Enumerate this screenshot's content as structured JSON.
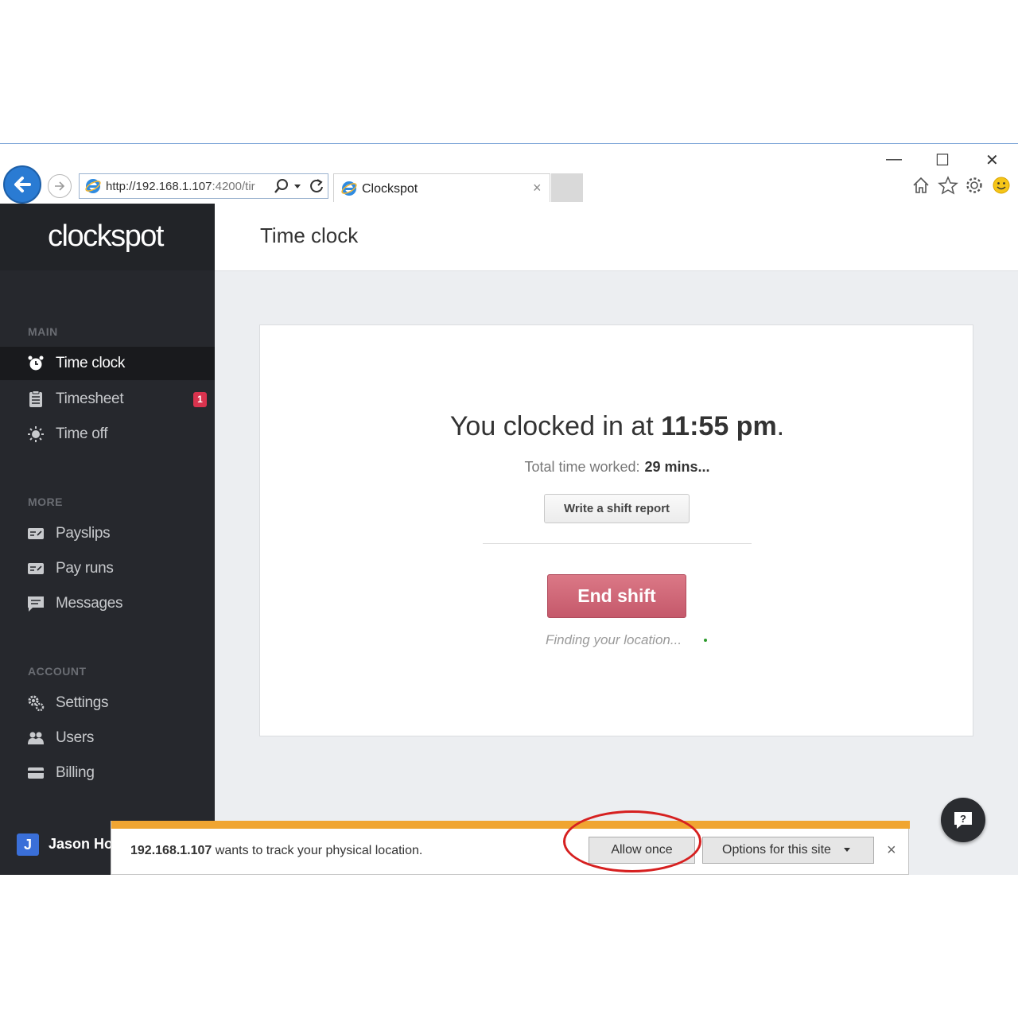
{
  "browser": {
    "url_main": "http://192.168.1.107",
    "url_port": ":4200/tir",
    "tab_title": "Clockspot",
    "tab_close": "×",
    "minimize": "—",
    "maximize": "☐",
    "close": "✕"
  },
  "sidebar": {
    "logo": "clockspot",
    "sections": {
      "main": "MAIN",
      "more": "MORE",
      "account": "ACCOUNT"
    },
    "items": [
      {
        "label": "Time clock",
        "icon": "alarm-clock-icon",
        "active": true
      },
      {
        "label": "Timesheet",
        "icon": "clipboard-icon",
        "badge": "1"
      },
      {
        "label": "Time off",
        "icon": "sun-icon"
      },
      {
        "label": "Payslips",
        "icon": "payslip-icon"
      },
      {
        "label": "Pay runs",
        "icon": "pay-runs-icon"
      },
      {
        "label": "Messages",
        "icon": "message-icon"
      },
      {
        "label": "Settings",
        "icon": "gears-icon"
      },
      {
        "label": "Users",
        "icon": "users-icon"
      },
      {
        "label": "Billing",
        "icon": "credit-card-icon"
      }
    ],
    "user": {
      "initial": "J",
      "name": "Jason Ho"
    }
  },
  "main": {
    "title": "Time clock",
    "clock_prefix": "You clocked in at ",
    "clock_time": "11:55 pm",
    "clock_suffix": ".",
    "total_label": "Total time worked:",
    "total_value": "29 mins...",
    "shift_report": "Write a shift report",
    "end_shift": "End shift",
    "finding": "Finding your location..."
  },
  "notification": {
    "host": "192.168.1.107",
    "message": " wants to track your physical location.",
    "allow": "Allow once",
    "options": "Options for this site",
    "close": "×"
  },
  "colors": {
    "sidebar_bg": "#26282d",
    "end_shift": "#c5596b",
    "badge": "#d9334e",
    "notify_stripe": "#f0a531",
    "highlight_ring": "#d62020"
  }
}
